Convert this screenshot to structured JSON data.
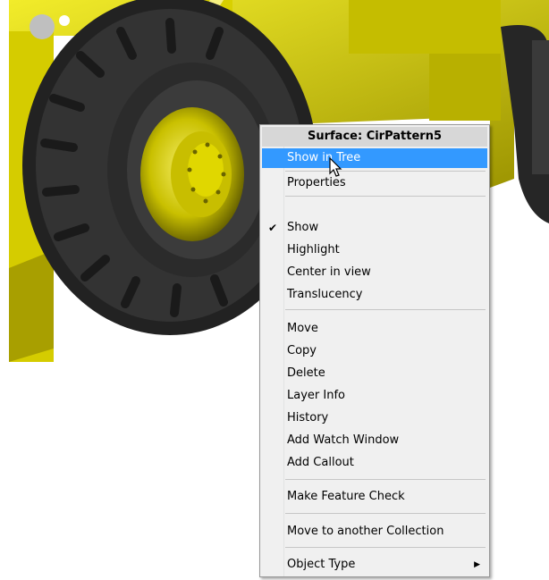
{
  "menu": {
    "title": "Surface: CirPattern5",
    "items": [
      {
        "label": "Show in Tree"
      },
      {
        "label": "Properties"
      },
      {
        "label": "Show"
      },
      {
        "label": "Highlight"
      },
      {
        "label": "Center in view"
      },
      {
        "label": "Translucency"
      },
      {
        "label": "Move"
      },
      {
        "label": "Copy"
      },
      {
        "label": "Delete"
      },
      {
        "label": "Layer Info"
      },
      {
        "label": "History"
      },
      {
        "label": "Add Watch Window"
      },
      {
        "label": "Add Callout"
      },
      {
        "label": "Make Feature Check"
      },
      {
        "label": "Move to another Collection"
      },
      {
        "label": "Object Type"
      }
    ],
    "highlighted_item": "Show in Tree",
    "checked_item": "Show",
    "check_glyph": "✔",
    "submenu_arrow": "▶"
  },
  "colors": {
    "highlight": "#3399ff",
    "body_yellow": "#e8e000",
    "tire": "#2a2a2a"
  }
}
